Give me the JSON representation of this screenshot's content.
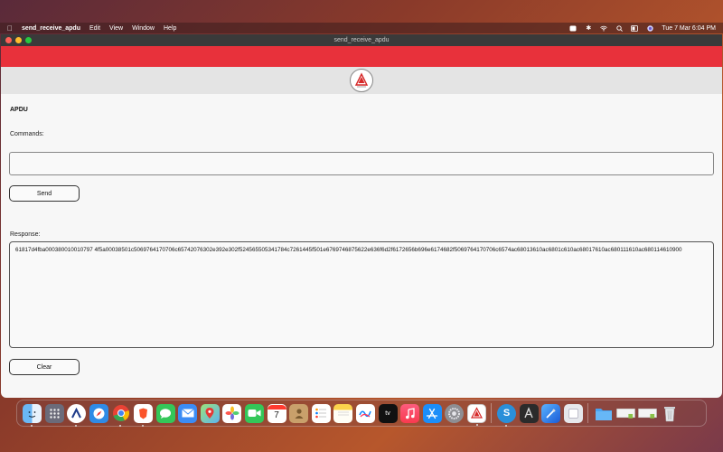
{
  "menubar": {
    "app_name": "send_receive_apdu",
    "menus": [
      "Edit",
      "View",
      "Window",
      "Help"
    ],
    "clock": "Tue 7 Mar  6:04 PM"
  },
  "window": {
    "title": "send_receive_apdu"
  },
  "colors": {
    "accent_red": "#e8313b",
    "window_bg": "#f7f7f7"
  },
  "main": {
    "heading": "APDU",
    "commands_label": "Commands:",
    "commands_value": "",
    "send_label": "Send",
    "response_label": "Response:",
    "response_value": "61817d4fba000380010010797 4f5a00038501c5069764170706c65742076302e392e302f524565505341784c7261445f501e6769746875622e636f6d2f6172656b696e6174682f5069764170706c6574ac68013610ac6801c610ac68017610ac680111610ac680114610900",
    "clear_label": "Clear"
  },
  "dock": {
    "icons": [
      "finder-icon",
      "launchpad-icon",
      "app-icon",
      "safari-icon",
      "chrome-icon",
      "brave-icon",
      "messages-icon",
      "mail-icon",
      "maps-icon",
      "photos-icon",
      "facetime-icon",
      "calendar-icon",
      "contacts-icon",
      "reminders-icon",
      "notes-icon",
      "freeform-icon",
      "tv-icon",
      "music-icon",
      "appstore-icon",
      "settings-icon",
      "apdu-app-icon",
      "skype-icon",
      "tools-icon",
      "xcode-icon",
      "preview-icon",
      "folder-icon",
      "document-icon",
      "document-icon-2",
      "trash-icon"
    ],
    "calendar_day": "7",
    "tv_label": "tv"
  }
}
